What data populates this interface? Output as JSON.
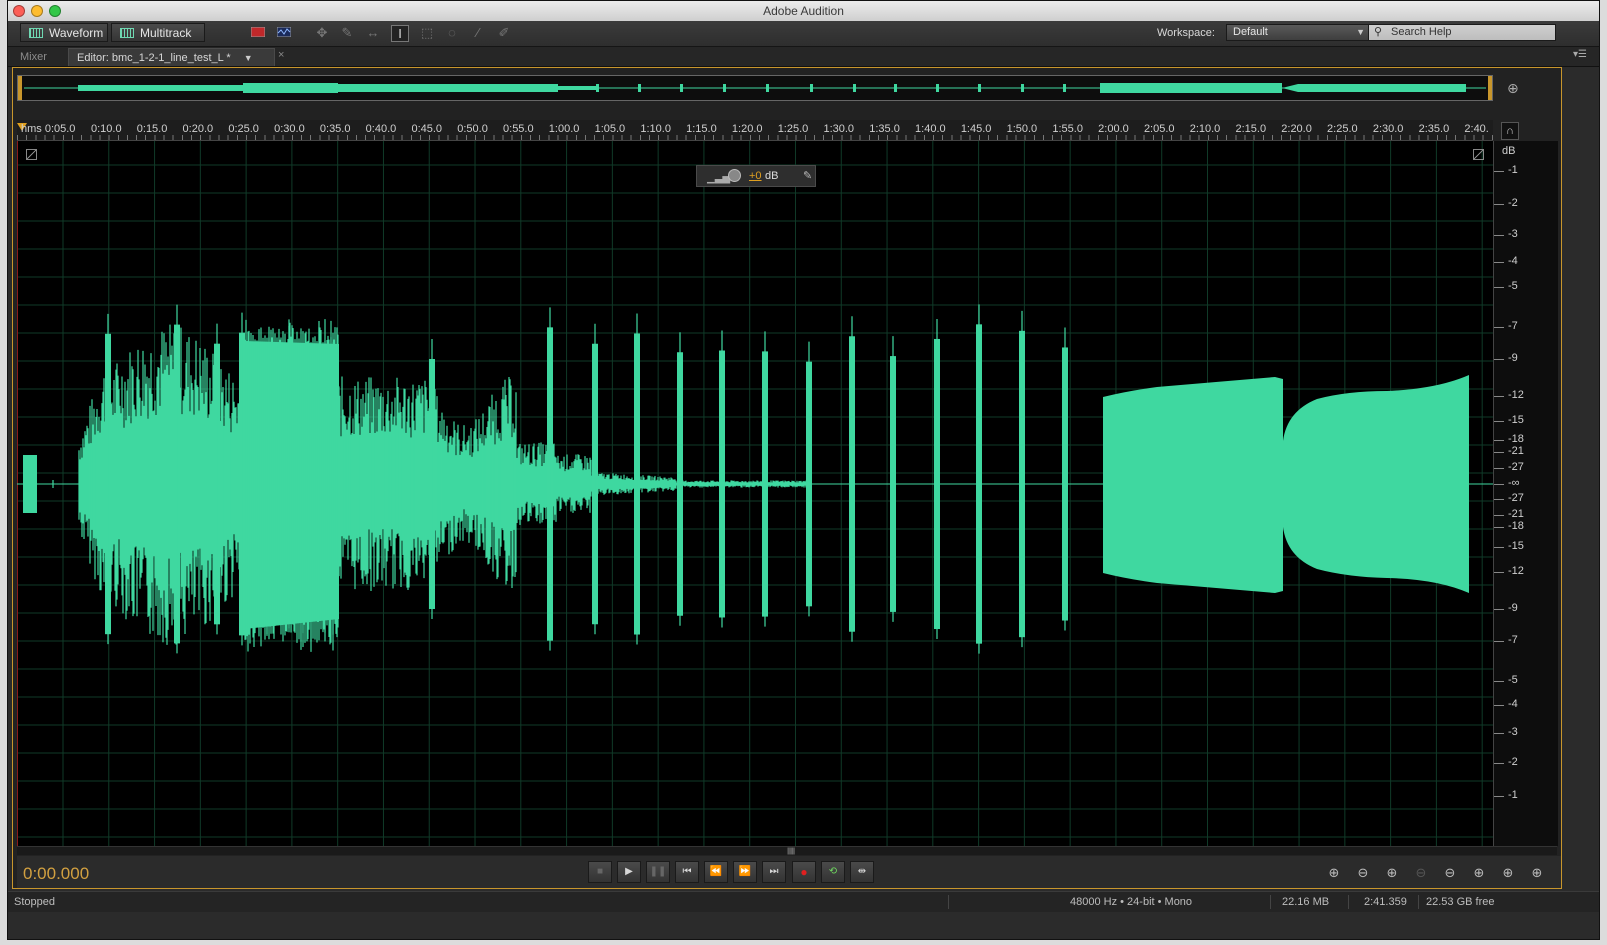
{
  "window": {
    "title": "Adobe Audition"
  },
  "toolbar": {
    "waveform_label": "Waveform",
    "multitrack_label": "Multitrack",
    "workspace_label": "Workspace:",
    "workspace_value": "Default",
    "search_placeholder": "Search Help"
  },
  "tabs": {
    "mixer_label": "Mixer",
    "editor_label": "Editor: bmc_1-2-1_line_test_L *"
  },
  "ruler": {
    "labels": [
      "hms 0:05.0",
      "0:10.0",
      "0:15.0",
      "0:20.0",
      "0:25.0",
      "0:30.0",
      "0:35.0",
      "0:40.0",
      "0:45.0",
      "0:50.0",
      "0:55.0",
      "1:00.0",
      "1:05.0",
      "1:10.0",
      "1:15.0",
      "1:20.0",
      "1:25.0",
      "1:30.0",
      "1:35.0",
      "1:40.0",
      "1:45.0",
      "1:50.0",
      "1:55.0",
      "2:00.0",
      "2:05.0",
      "2:10.0",
      "2:15.0",
      "2:20.0",
      "2:25.0",
      "2:30.0",
      "2:35.0",
      "2:40."
    ]
  },
  "hud": {
    "gain_value": "+0",
    "gain_unit": "dB"
  },
  "db_scale": {
    "unit": "dB",
    "labels": [
      "-1",
      "-2",
      "-3",
      "-4",
      "-5",
      "-7",
      "-9",
      "-12",
      "-15",
      "-18",
      "-21",
      "-27",
      "-∞",
      "-27",
      "-21",
      "-18",
      "-15",
      "-12",
      "-9",
      "-7",
      "-5",
      "-4",
      "-3",
      "-2",
      "-1"
    ]
  },
  "transport": {
    "timecode": "0:00.000"
  },
  "status": {
    "state": "Stopped",
    "format": "48000 Hz • 24-bit • Mono",
    "file_size": "22.16 MB",
    "duration": "2:41.359",
    "free_space": "22.53 GB free"
  },
  "colors": {
    "waveform": "#3fd8a0",
    "accent": "#c8962c",
    "timecode": "#d2a040"
  }
}
